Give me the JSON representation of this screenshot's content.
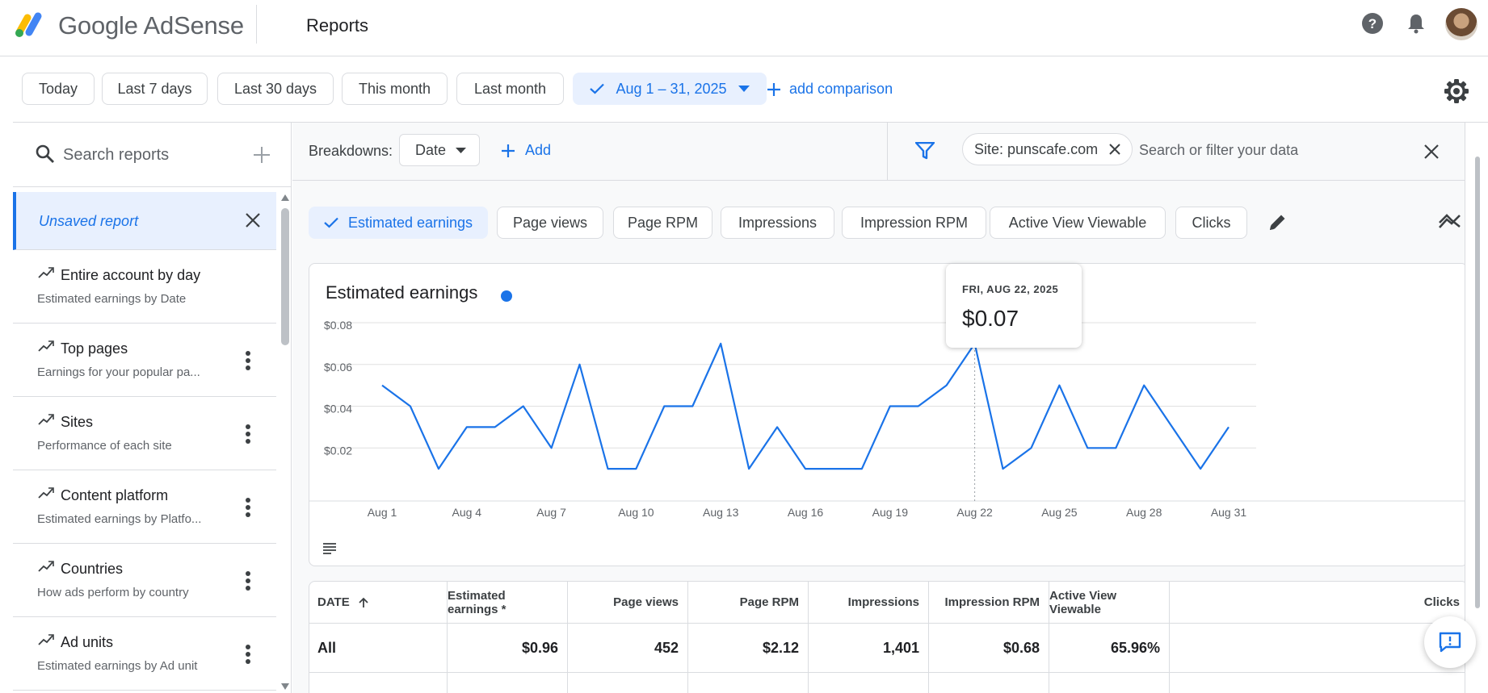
{
  "app": {
    "brand": "Google AdSense",
    "page_title": "Reports"
  },
  "datebar": {
    "chips": [
      "Today",
      "Last 7 days",
      "Last 30 days",
      "This month",
      "Last month"
    ],
    "active_range": "Aug 1 – 31, 2025",
    "add_comparison": "add comparison"
  },
  "sidebar": {
    "search_placeholder": "Search reports",
    "unsaved": "Unsaved report",
    "reports": [
      {
        "title": "Entire account by day",
        "sub": "Estimated earnings by Date"
      },
      {
        "title": "Top pages",
        "sub": "Earnings for your popular pa..."
      },
      {
        "title": "Sites",
        "sub": "Performance of each site"
      },
      {
        "title": "Content platform",
        "sub": "Estimated earnings by Platfo..."
      },
      {
        "title": "Countries",
        "sub": "How ads perform by country"
      },
      {
        "title": "Ad units",
        "sub": "Estimated earnings by Ad unit"
      }
    ]
  },
  "breakdowns": {
    "label": "Breakdowns:",
    "date_chip": "Date",
    "add": "Add"
  },
  "filter": {
    "site_chip": "Site: punscafe.com",
    "search_placeholder": "Search or filter your data"
  },
  "metrics": [
    "Estimated earnings",
    "Page views",
    "Page RPM",
    "Impressions",
    "Impression RPM",
    "Active View Viewable",
    "Clicks"
  ],
  "chart_card": {
    "title": "Estimated earnings",
    "tooltip_date": "FRI, AUG 22, 2025",
    "tooltip_value": "$0.07"
  },
  "chart_data": {
    "type": "line",
    "title": "Estimated earnings",
    "xlabel": "",
    "ylabel": "",
    "x": [
      "Aug 1",
      "Aug 2",
      "Aug 3",
      "Aug 4",
      "Aug 5",
      "Aug 6",
      "Aug 7",
      "Aug 8",
      "Aug 9",
      "Aug 10",
      "Aug 11",
      "Aug 12",
      "Aug 13",
      "Aug 14",
      "Aug 15",
      "Aug 16",
      "Aug 17",
      "Aug 18",
      "Aug 19",
      "Aug 20",
      "Aug 21",
      "Aug 22",
      "Aug 23",
      "Aug 24",
      "Aug 25",
      "Aug 26",
      "Aug 27",
      "Aug 28",
      "Aug 29",
      "Aug 30",
      "Aug 31"
    ],
    "x_ticks": [
      "Aug 1",
      "Aug 4",
      "Aug 7",
      "Aug 10",
      "Aug 13",
      "Aug 16",
      "Aug 19",
      "Aug 22",
      "Aug 25",
      "Aug 28",
      "Aug 31"
    ],
    "y_ticks": [
      "$0.08",
      "$0.06",
      "$0.04",
      "$0.02"
    ],
    "series": [
      {
        "values": [
          0.05,
          0.04,
          0.01,
          0.03,
          0.03,
          0.04,
          0.02,
          0.06,
          0.01,
          0.01,
          0.04,
          0.04,
          0.07,
          0.01,
          0.03,
          0.01,
          0.01,
          0.01,
          0.04,
          0.04,
          0.05,
          0.07,
          0.01,
          0.02,
          0.05,
          0.02,
          0.02,
          0.05,
          0.03,
          0.01,
          0.03
        ]
      }
    ],
    "ylim": [
      0,
      0.08
    ],
    "highlight_index": 21,
    "color": "#1a73e8",
    "grid": true
  },
  "table": {
    "headers": [
      "DATE",
      "Estimated earnings *",
      "Page views",
      "Page RPM",
      "Impressions",
      "Impression RPM",
      "Active View Viewable",
      "Clicks"
    ],
    "total_row": [
      "All",
      "$0.96",
      "452",
      "$2.12",
      "1,401",
      "$0.68",
      "65.96%",
      ""
    ]
  },
  "colors": {
    "accent": "#1a73e8",
    "border": "#dadce0",
    "active_bg": "#e8f0fe"
  }
}
